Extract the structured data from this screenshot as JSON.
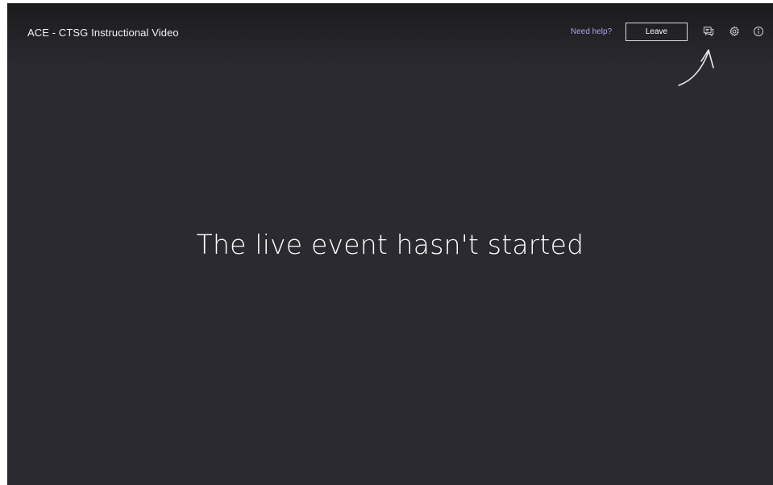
{
  "header": {
    "title": "ACE - CTSG Instructional Video",
    "help_link": "Need help?",
    "leave_label": "Leave",
    "icons": [
      "chat-icon",
      "gear-icon",
      "info-icon"
    ]
  },
  "main": {
    "status_message": "The live event hasn't started"
  },
  "colors": {
    "background": "#2b2a31",
    "topbar": "#1b1b1d",
    "link": "#a9a6e6",
    "text": "#ffffff"
  }
}
